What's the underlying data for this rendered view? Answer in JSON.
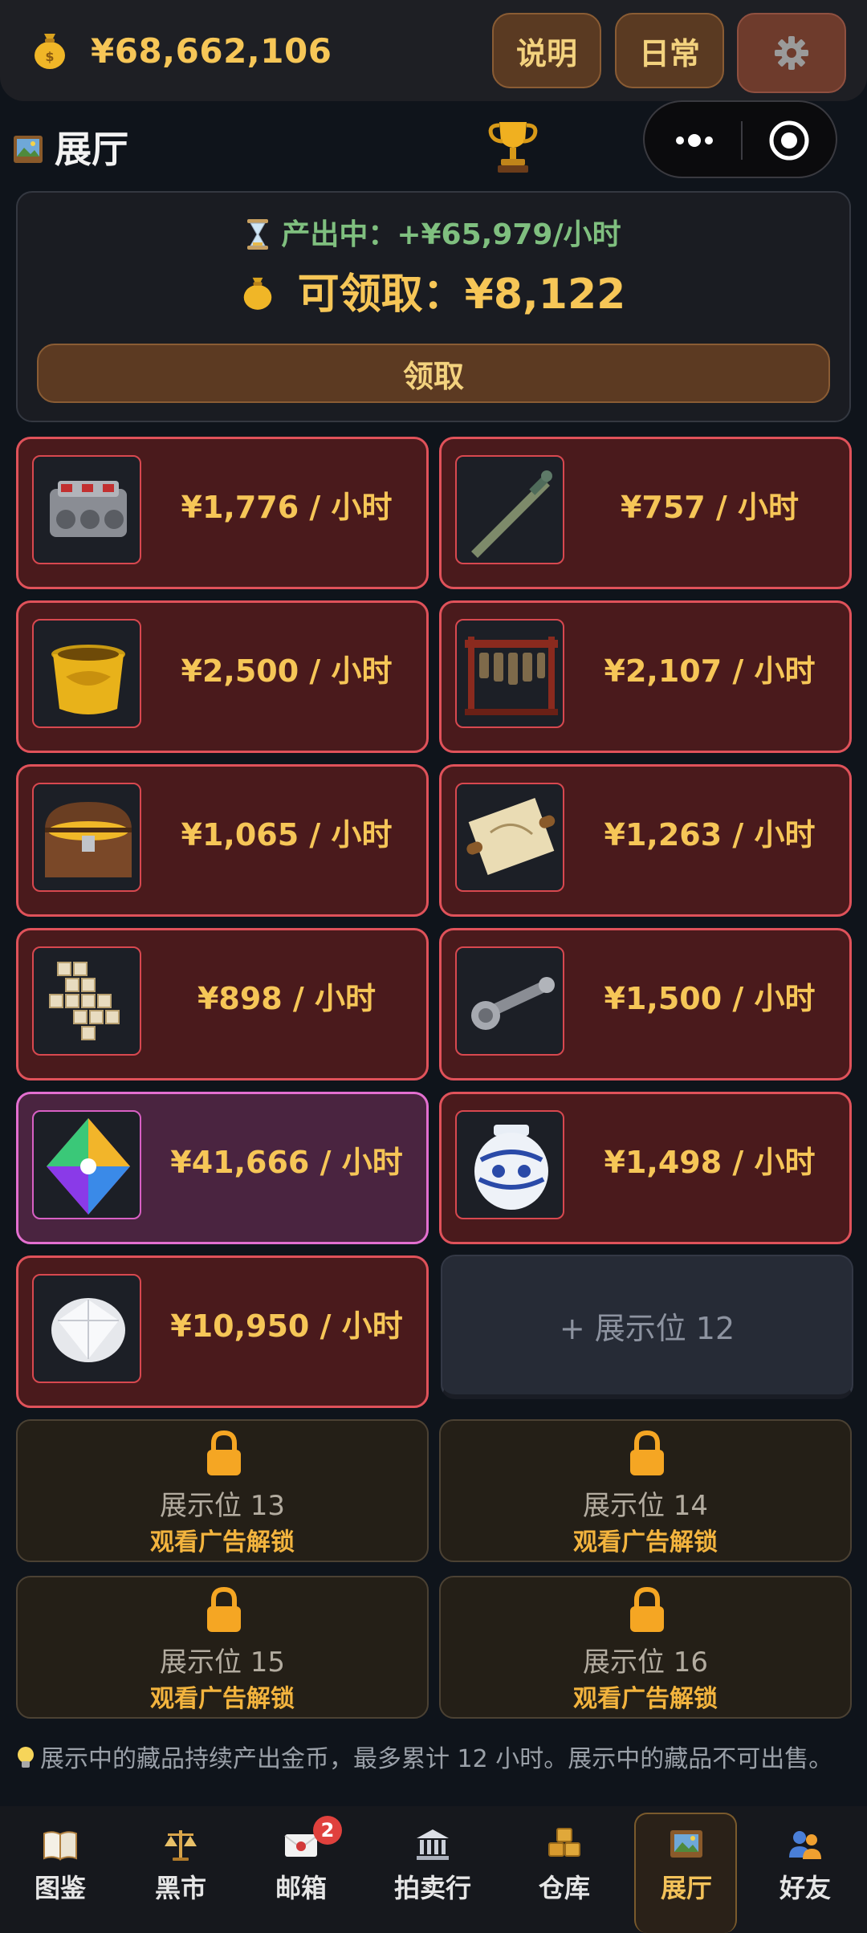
{
  "header": {
    "money": "¥68,662,106",
    "buttons": {
      "help": "说明",
      "daily": "日常"
    }
  },
  "title": "展厅",
  "panel": {
    "producing": "产出中：+¥65,979/小时",
    "claimable": "可领取：¥8,122",
    "claim_button": "领取"
  },
  "slots": [
    {
      "item": "engine-icon",
      "rate": "¥1,776 / 小时"
    },
    {
      "item": "sword-icon",
      "rate": "¥757 / 小时"
    },
    {
      "item": "golden-pot-icon",
      "rate": "¥2,500 / 小时"
    },
    {
      "item": "chime-bells-icon",
      "rate": "¥2,107 / 小时"
    },
    {
      "item": "treasure-chest-icon",
      "rate": "¥1,065 / 小时"
    },
    {
      "item": "scroll-icon",
      "rate": "¥1,263 / 小时"
    },
    {
      "item": "jade-suit-icon",
      "rate": "¥898 / 小时"
    },
    {
      "item": "scepter-icon",
      "rate": "¥1,500 / 小时"
    },
    {
      "item": "rainbow-gem-icon",
      "rate": "¥41,666 / 小时"
    },
    {
      "item": "porcelain-jar-icon",
      "rate": "¥1,498 / 小时"
    },
    {
      "item": "diamond-icon",
      "rate": "¥10,950 / 小时"
    }
  ],
  "empty_slot": "+ 展示位 12",
  "locked_slots": [
    {
      "name": "展示位 13",
      "action": "观看广告解锁"
    },
    {
      "name": "展示位 14",
      "action": "观看广告解锁"
    },
    {
      "name": "展示位 15",
      "action": "观看广告解锁"
    },
    {
      "name": "展示位 16",
      "action": "观看广告解锁"
    }
  ],
  "tip": "展示中的藏品持续产出金币，最多累计 12 小时。展示中的藏品不可出售。",
  "nav": [
    {
      "label": "图鉴",
      "icon": "book-icon"
    },
    {
      "label": "黑市",
      "icon": "scale-icon"
    },
    {
      "label": "邮箱",
      "icon": "mail-icon",
      "badge": "2"
    },
    {
      "label": "拍卖行",
      "icon": "bank-icon"
    },
    {
      "label": "仓库",
      "icon": "crates-icon"
    },
    {
      "label": "展厅",
      "icon": "gallery-icon",
      "active": true
    },
    {
      "label": "好友",
      "icon": "friends-icon"
    }
  ],
  "colors": {
    "gold": "#f6c657",
    "slot_red": "#e0525a",
    "slot_purple": "#e36fd0",
    "green": "#7fbf7f"
  }
}
